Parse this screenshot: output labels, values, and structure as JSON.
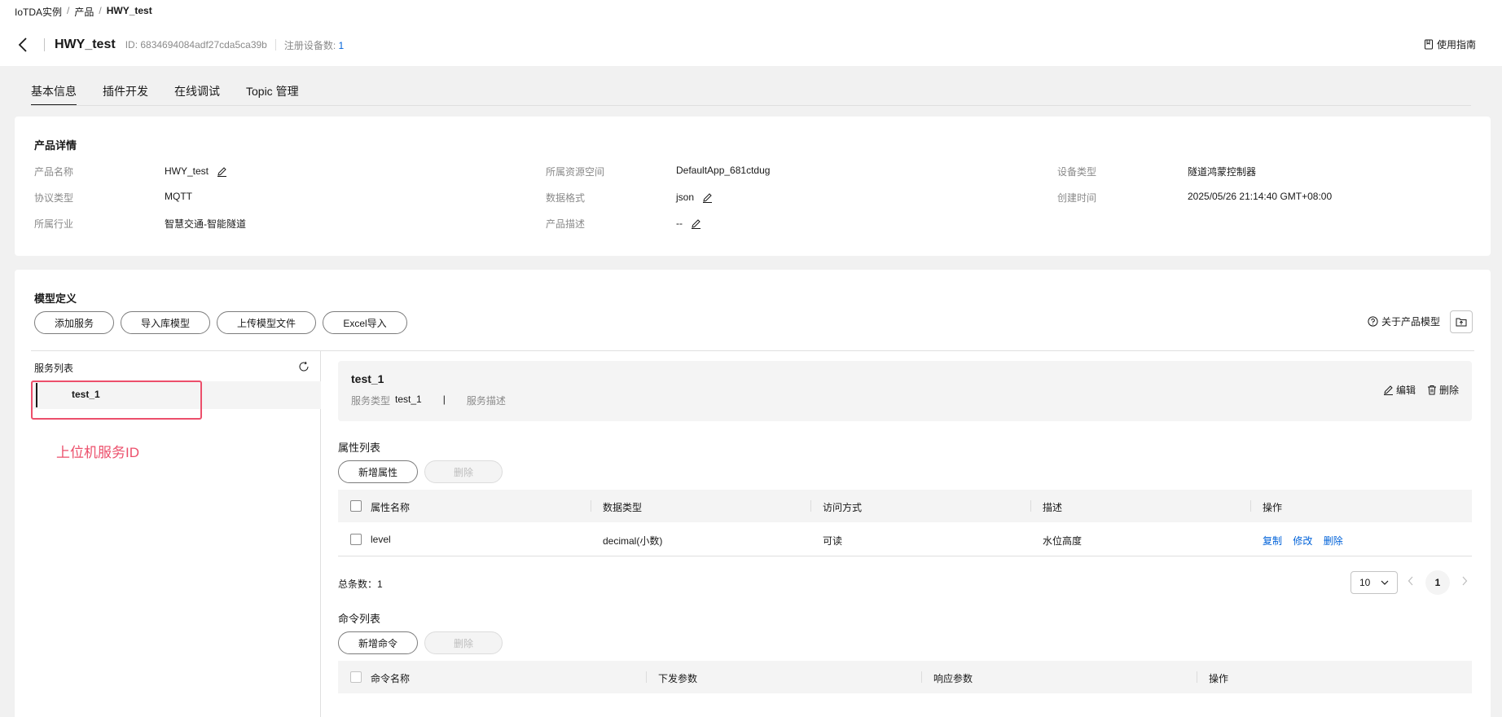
{
  "breadcrumb": {
    "items": [
      "IoTDA实例",
      "产品",
      "HWY_test"
    ]
  },
  "header": {
    "title": "HWY_test",
    "id_text": "ID: 6834694084adf27cda5ca39b",
    "registered_label": "注册设备数:",
    "registered_count": "1",
    "guide_label": "使用指南"
  },
  "tabs": [
    {
      "label": "基本信息",
      "active": true
    },
    {
      "label": "插件开发"
    },
    {
      "label": "在线调试"
    },
    {
      "label": "Topic 管理"
    }
  ],
  "product_details": {
    "title": "产品详情",
    "fields": [
      {
        "label": "产品名称",
        "value": "HWY_test"
      },
      {
        "label": "协议类型",
        "value": "MQTT"
      },
      {
        "label": "所属行业",
        "value": "智慧交通-智能隧道"
      },
      {
        "label": "所属资源空间",
        "value": "DefaultApp_681ctdug"
      },
      {
        "label": "数据格式",
        "value": "json"
      },
      {
        "label": "产品描述",
        "value": "--"
      },
      {
        "label": "设备类型",
        "value": "隧道鸿蒙控制器"
      },
      {
        "label": "创建时间",
        "value": "2025/05/26 21:14:40 GMT+08:00"
      }
    ]
  },
  "model": {
    "title": "模型定义",
    "buttons": [
      "添加服务",
      "导入库模型",
      "上传模型文件",
      "Excel导入"
    ],
    "about_label": "关于产品模型",
    "service_list_title": "服务列表",
    "services": [
      "test_1"
    ],
    "annotation": "上位机服务ID"
  },
  "service": {
    "name": "test_1",
    "type_label": "服务类型",
    "type_value": "test_1",
    "separator": "|",
    "desc_label": "服务描述",
    "edit_label": "编辑",
    "delete_label": "删除"
  },
  "properties": {
    "title": "属性列表",
    "add_label": "新增属性",
    "delete_label": "删除",
    "columns": [
      "属性名称",
      "数据类型",
      "访问方式",
      "描述",
      "操作"
    ],
    "rows": [
      {
        "name": "level",
        "type": "decimal(小数)",
        "access": "可读",
        "desc": "水位高度",
        "actions": [
          "复制",
          "修改",
          "删除"
        ]
      }
    ],
    "total_label": "总条数：1",
    "page_size": "10",
    "page": "1"
  },
  "commands": {
    "title": "命令列表",
    "add_label": "新增命令",
    "delete_label": "删除",
    "columns": [
      "命令名称",
      "下发参数",
      "响应参数",
      "操作"
    ]
  },
  "colors": {
    "accent": "#0062d9",
    "annotation": "#ec4f6b",
    "text": "#191919",
    "muted": "#8a8a8a"
  }
}
